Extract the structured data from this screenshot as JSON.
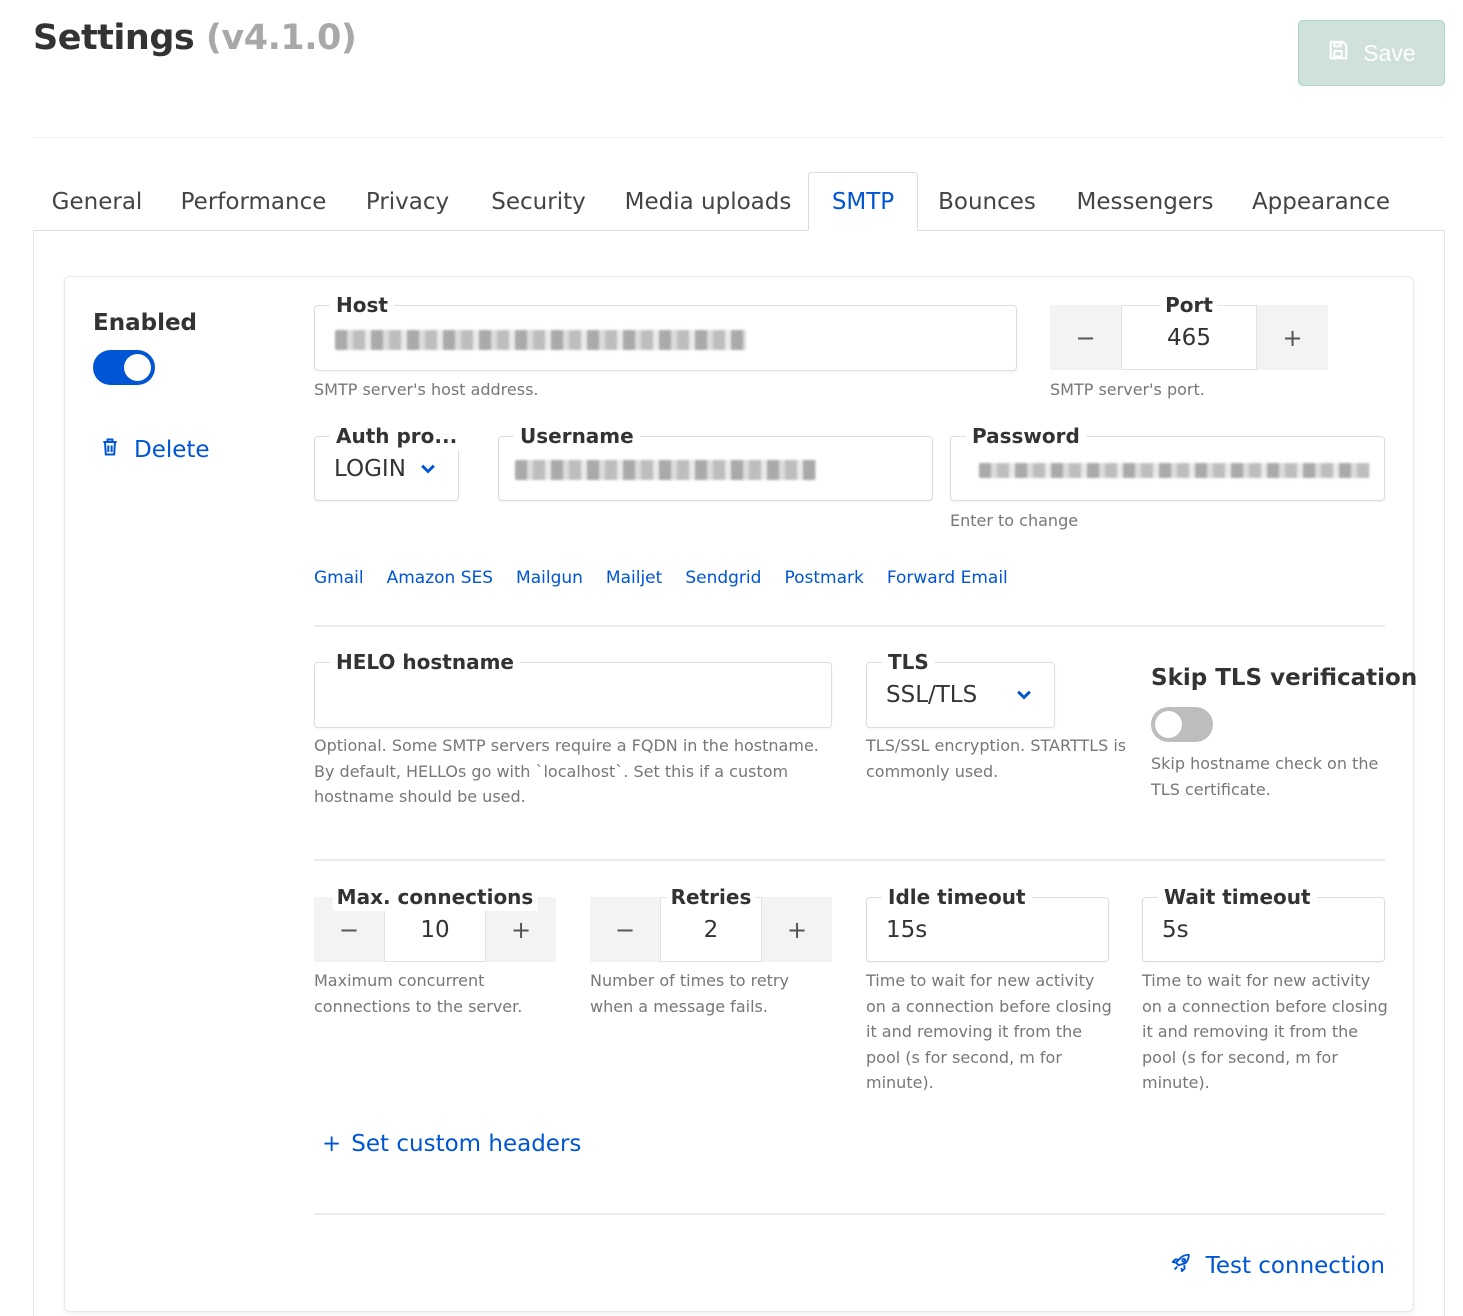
{
  "header": {
    "title": "Settings",
    "version": "(v4.1.0)",
    "save_label": "Save"
  },
  "tabs": [
    {
      "label": "General"
    },
    {
      "label": "Performance"
    },
    {
      "label": "Privacy"
    },
    {
      "label": "Security"
    },
    {
      "label": "Media uploads"
    },
    {
      "label": "SMTP",
      "active": true
    },
    {
      "label": "Bounces"
    },
    {
      "label": "Messengers"
    },
    {
      "label": "Appearance"
    }
  ],
  "smtp": {
    "enabled_label": "Enabled",
    "enabled": true,
    "delete_label": "Delete",
    "host": {
      "label": "Host",
      "help": "SMTP server's host address."
    },
    "port": {
      "label": "Port",
      "value": "465",
      "help": "SMTP server's port."
    },
    "auth": {
      "label": "Auth pro...",
      "value": "LOGIN"
    },
    "username": {
      "label": "Username"
    },
    "password": {
      "label": "Password",
      "help": "Enter to change"
    },
    "presets": [
      "Gmail",
      "Amazon SES",
      "Mailgun",
      "Mailjet",
      "Sendgrid",
      "Postmark",
      "Forward Email"
    ],
    "helo": {
      "label": "HELO hostname",
      "value": "",
      "help": "Optional. Some SMTP servers require a FQDN in the hostname. By default, HELLOs go with `localhost`. Set this if a custom hostname should be used."
    },
    "tls": {
      "label": "TLS",
      "value": "SSL/TLS",
      "help": "TLS/SSL encryption. STARTTLS is commonly used."
    },
    "skip_tls": {
      "label": "Skip TLS verification",
      "enabled": false,
      "help": "Skip hostname check on the TLS certificate."
    },
    "max_conn": {
      "label": "Max. connections",
      "value": "10",
      "help": "Maximum concurrent connections to the server."
    },
    "retries": {
      "label": "Retries",
      "value": "2",
      "help": "Number of times to retry when a message fails."
    },
    "idle_timeout": {
      "label": "Idle timeout",
      "value": "15s",
      "help": "Time to wait for new activity on a connection before closing it and removing it from the pool (s for second, m for minute)."
    },
    "wait_timeout": {
      "label": "Wait timeout",
      "value": "5s",
      "help": "Time to wait for new activity on a connection before closing it and removing it from the pool (s for second, m for minute)."
    },
    "custom_headers_label": "Set custom headers",
    "test_label": "Test connection"
  },
  "colors": {
    "accent": "#0055d4",
    "save_disabled_bg": "#cfe1da"
  },
  "icons": {
    "save": "floppy-disk-icon",
    "delete": "trash-icon",
    "select": "chevron-down-icon",
    "add": "plus-icon",
    "test": "rocket-icon"
  }
}
